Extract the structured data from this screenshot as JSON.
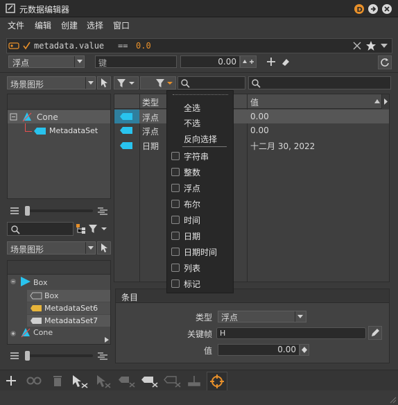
{
  "window": {
    "title": "元数据编辑器"
  },
  "menubar": [
    "文件",
    "编辑",
    "创建",
    "选择",
    "窗口"
  ],
  "expression": {
    "prefix": "metadata.value",
    "operator": "==",
    "value": "0.0"
  },
  "filter_row": {
    "type_value": "浮点",
    "key_placeholder": "键",
    "number_value": "0.00"
  },
  "left_top": {
    "dropdown": "场景图形",
    "tree": [
      {
        "label": "Cone"
      },
      {
        "label": "MetadataSet"
      }
    ]
  },
  "left_bottom": {
    "dropdown": "场景图形",
    "tree": [
      {
        "label": "Box"
      },
      {
        "label": "Box"
      },
      {
        "label": "MetadataSet6"
      },
      {
        "label": "MetadataSet7"
      },
      {
        "label": "Cone"
      }
    ]
  },
  "table": {
    "headers": {
      "type": "类型",
      "value": "值"
    },
    "rows": [
      {
        "type": "浮点",
        "value": "0.00"
      },
      {
        "type": "浮点",
        "value": "0.00"
      },
      {
        "type": "日期",
        "value": "十二月 30, 2022"
      }
    ]
  },
  "filter_menu": {
    "actions": [
      "全选",
      "不选",
      "反向选择"
    ],
    "types": [
      "字符串",
      "整数",
      "浮点",
      "布尔",
      "时间",
      "日期",
      "日期时间",
      "列表",
      "标记"
    ]
  },
  "entry_panel": {
    "title": "条目",
    "type_label": "类型",
    "type_value": "浮点",
    "keyframe_label": "关键帧",
    "keyframe_value": "H",
    "value_label": "值",
    "value_value": "0.00"
  },
  "colors": {
    "accent": "#e8902a",
    "cyan": "#29c3ee",
    "yellow": "#e7b43a"
  }
}
